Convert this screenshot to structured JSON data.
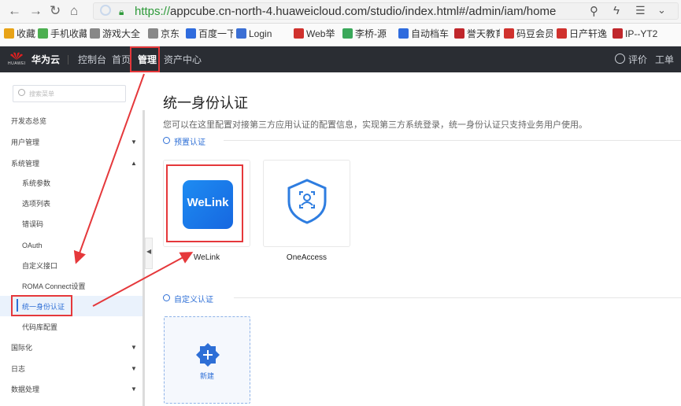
{
  "browser": {
    "url_scheme": "https://",
    "url_rest": "appcube.cn-north-4.huaweicloud.com/studio/index.html#/admin/iam/home",
    "bookmarks": [
      {
        "label": "收藏",
        "color": "#e8a317"
      },
      {
        "label": "手机收藏夹",
        "color": "#4caf50"
      },
      {
        "label": "游戏大全",
        "color": "#888888"
      },
      {
        "label": "京东",
        "color": "#888888"
      },
      {
        "label": "百度一下",
        "color": "#2f6cde"
      },
      {
        "label": "Login",
        "color": "#3b6fd4"
      },
      {
        "label": "Web举",
        "color": "#d0312d"
      },
      {
        "label": "李桥-源",
        "color": "#3aa85a"
      },
      {
        "label": "自动档车",
        "color": "#2f6cde"
      },
      {
        "label": "誉天教育",
        "color": "#c0262b"
      },
      {
        "label": "码豆会员",
        "color": "#d0312d"
      },
      {
        "label": "日产轩逸",
        "color": "#d0312d"
      },
      {
        "label": "IP--YT2",
        "color": "#c0262b"
      }
    ]
  },
  "topbar": {
    "brand": "华为云",
    "logo_text": "HUAWEI",
    "nav": [
      "控制台",
      "首页",
      "管理",
      "资产中心"
    ],
    "active": "管理",
    "right": [
      "评价",
      "工单"
    ]
  },
  "sidebar": {
    "search_placeholder": "搜索菜单",
    "items": [
      {
        "label": "开发态总览"
      },
      {
        "label": "用户管理",
        "caret": "▼"
      },
      {
        "label": "系统管理",
        "caret": "▲"
      },
      {
        "label": "系统参数"
      },
      {
        "label": "选项列表"
      },
      {
        "label": "错误码"
      },
      {
        "label": "OAuth"
      },
      {
        "label": "自定义接口"
      },
      {
        "label": "ROMA Connect设置"
      },
      {
        "label": "统一身份认证"
      },
      {
        "label": "代码库配置"
      },
      {
        "label": "国际化",
        "caret": "▼"
      },
      {
        "label": "日志",
        "caret": "▼"
      },
      {
        "label": "数据处理",
        "caret": "▼"
      }
    ],
    "selected": "统一身份认证"
  },
  "main": {
    "title": "统一身份认证",
    "description": "您可以在这里配置对接第三方应用认证的配置信息，实现第三方系统登录，统一身份认证只支持业务用户使用。",
    "preset_section": "预置认证",
    "preset_cards": [
      {
        "logo_text": "WeLink",
        "label": "WeLink",
        "icon": "welink-logo-icon"
      },
      {
        "label": "OneAccess",
        "icon": "oneaccess-shield-icon"
      }
    ],
    "custom_section": "自定义认证",
    "new_label": "新建"
  },
  "colors": {
    "accent": "#2e6fd6",
    "annotation_red": "#e5383b",
    "topbar_bg": "#2a2d33",
    "welink_blue": "#1677e6"
  }
}
